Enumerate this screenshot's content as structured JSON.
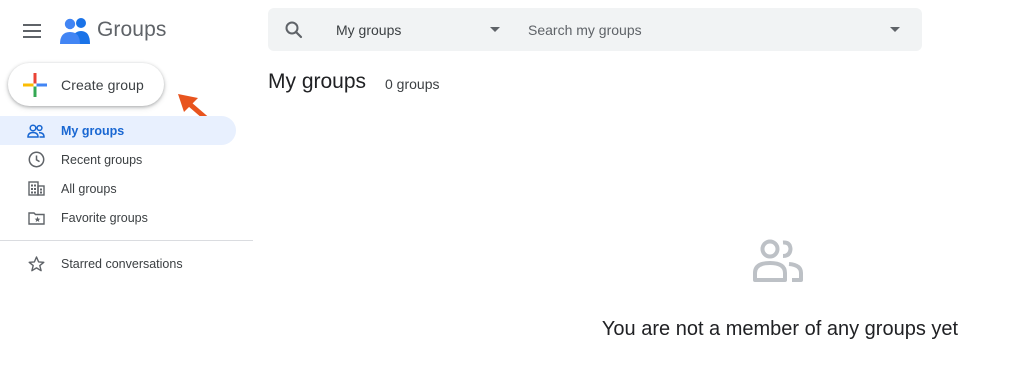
{
  "app": {
    "title": "Groups",
    "logo_icon": "groups-logo-icon"
  },
  "header": {
    "menu_icon": "hamburger-menu-icon"
  },
  "create_button": {
    "label": "Create group",
    "icon": "multicolor-plus-icon"
  },
  "sidebar": {
    "items": [
      {
        "label": "My groups",
        "icon": "people-outline-icon",
        "active": true
      },
      {
        "label": "Recent groups",
        "icon": "clock-icon",
        "active": false
      },
      {
        "label": "All groups",
        "icon": "building-icon",
        "active": false
      },
      {
        "label": "Favorite groups",
        "icon": "folder-star-icon",
        "active": false
      }
    ],
    "starred": {
      "label": "Starred conversations",
      "icon": "star-outline-icon"
    }
  },
  "search": {
    "icon": "search-icon",
    "scope_value": "My groups",
    "placeholder": "Search my groups"
  },
  "main": {
    "title": "My groups",
    "count": "0 groups",
    "empty_state": {
      "icon": "people-icon",
      "message": "You are not a member of any groups yet"
    }
  },
  "colors": {
    "accent": "#1967d2",
    "active_bg": "#e8f0fe",
    "search_bg": "#f1f3f4",
    "annotation_arrow": "#e8541e"
  }
}
